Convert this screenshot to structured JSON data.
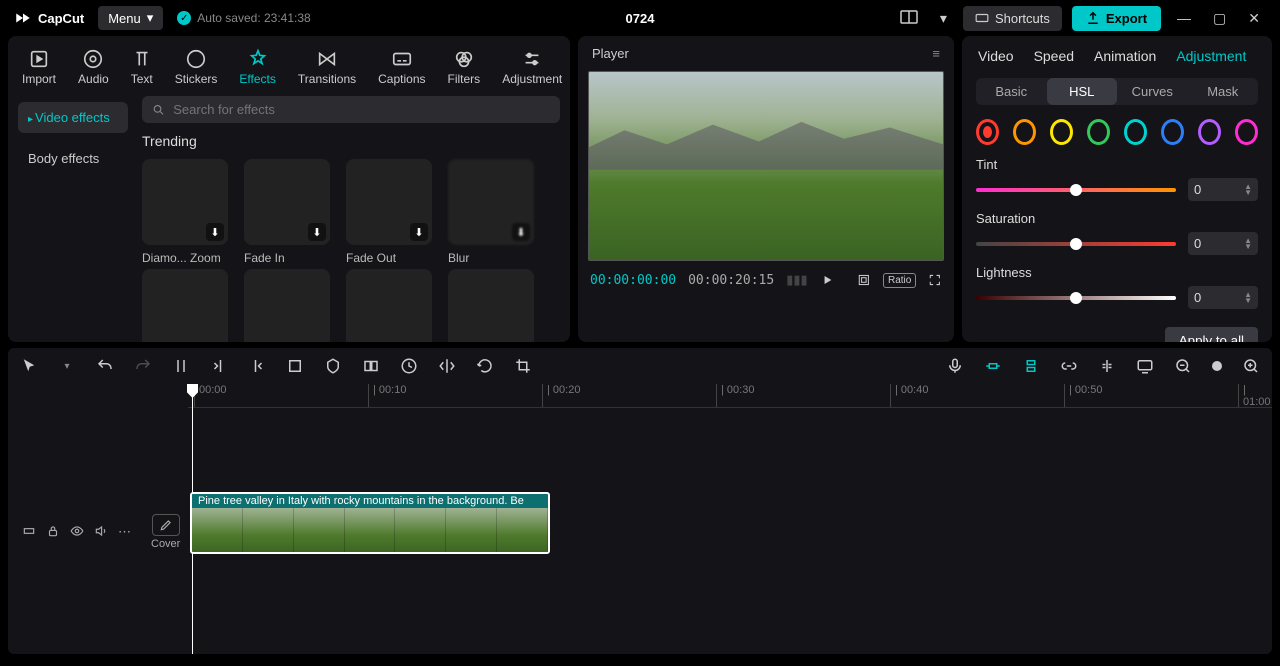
{
  "app": {
    "name": "CapCut",
    "menu": "Menu",
    "autosave": "Auto saved: 23:41:38",
    "project": "0724",
    "shortcuts": "Shortcuts",
    "export": "Export"
  },
  "media_tabs": [
    "Import",
    "Audio",
    "Text",
    "Stickers",
    "Effects",
    "Transitions",
    "Captions",
    "Filters",
    "Adjustment"
  ],
  "media_active": "Effects",
  "sidebar": {
    "video_effects": "Video effects",
    "body_effects": "Body effects"
  },
  "search_placeholder": "Search for effects",
  "section": "Trending",
  "effects_row1": [
    "Diamo... Zoom",
    "Fade In",
    "Fade Out",
    "Blur"
  ],
  "player": {
    "title": "Player",
    "cur": "00:00:00:00",
    "dur": "00:00:20:15",
    "ratio": "Ratio"
  },
  "inspector": {
    "tabs": [
      "Video",
      "Speed",
      "Animation",
      "Adjustment"
    ],
    "active": "Adjustment",
    "subtabs": [
      "Basic",
      "HSL",
      "Curves",
      "Mask"
    ],
    "sub_active": "HSL",
    "colors": [
      "#ff3b30",
      "#ff9500",
      "#ffe600",
      "#34c759",
      "#00d1d1",
      "#2d7ff9",
      "#b45cff",
      "#ff2dd1"
    ],
    "controls": [
      {
        "label": "Tint",
        "value": 0
      },
      {
        "label": "Saturation",
        "value": 0
      },
      {
        "label": "Lightness",
        "value": 0
      }
    ],
    "apply": "Apply to all"
  },
  "timeline": {
    "ticks": [
      "00:00",
      "00:10",
      "00:20",
      "00:30",
      "00:40",
      "00:50",
      "01:00"
    ],
    "cover": "Cover",
    "clip_label": "Pine tree valley in Italy with rocky mountains in the background. Be"
  }
}
